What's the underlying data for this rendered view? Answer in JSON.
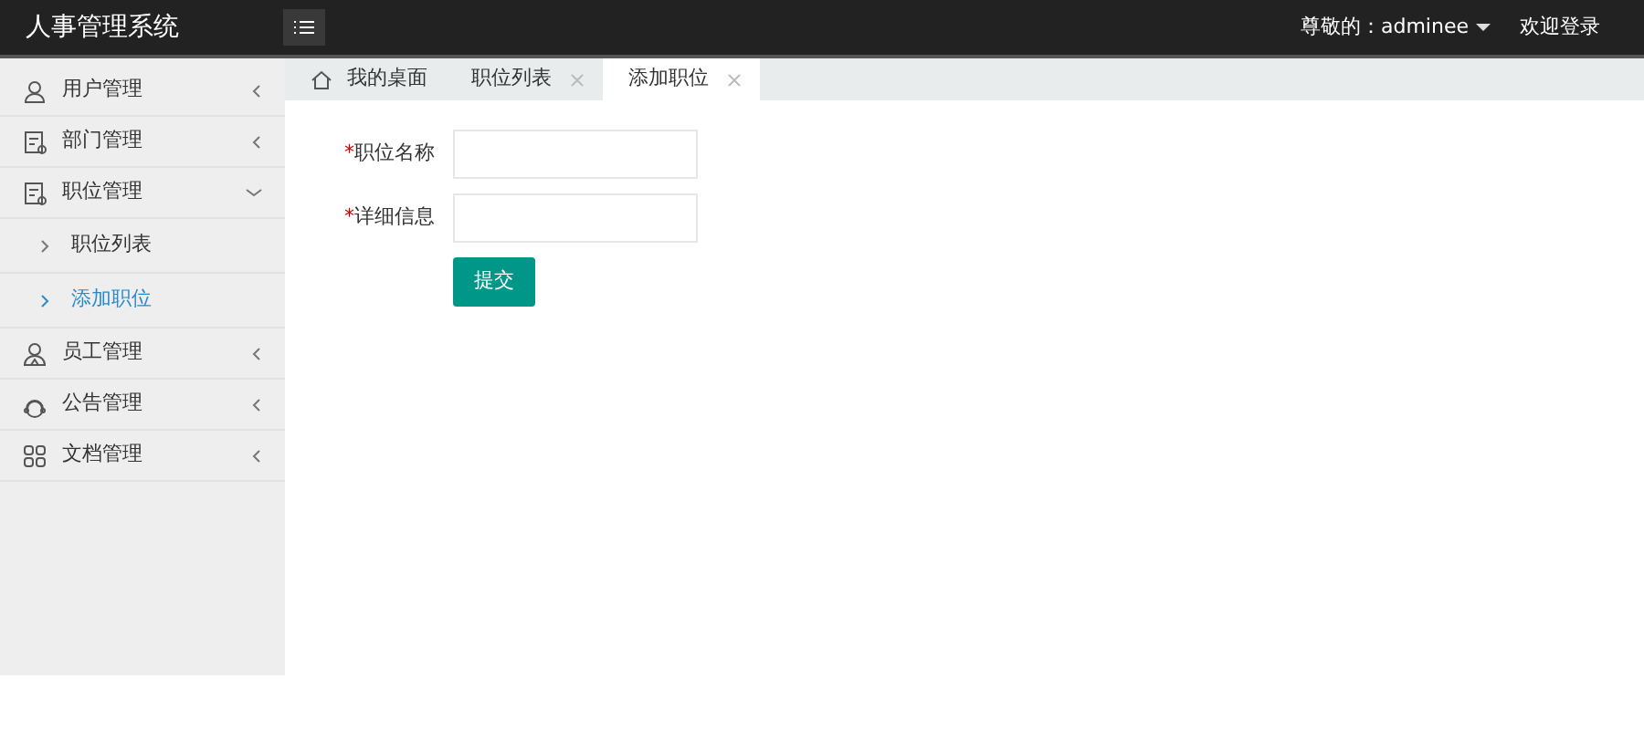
{
  "header": {
    "title": "人事管理系统",
    "user": "尊敬的：adminee",
    "welcome": "欢迎登录"
  },
  "sidebar": {
    "items": [
      {
        "label": "用户管理",
        "expanded": false
      },
      {
        "label": "部门管理",
        "expanded": false
      },
      {
        "label": "职位管理",
        "expanded": true,
        "children": [
          {
            "label": "职位列表",
            "selected": false
          },
          {
            "label": "添加职位",
            "selected": true
          }
        ]
      },
      {
        "label": "员工管理",
        "expanded": false
      },
      {
        "label": "公告管理",
        "expanded": false
      },
      {
        "label": "文档管理",
        "expanded": false
      }
    ]
  },
  "tabs": [
    {
      "label": "我的桌面",
      "kind": "home",
      "selected": false
    },
    {
      "label": "职位列表",
      "kind": "page",
      "selected": false
    },
    {
      "label": "添加职位",
      "kind": "page",
      "selected": true
    }
  ],
  "form": {
    "fields": [
      {
        "required_mark": "*",
        "label": "职位名称"
      },
      {
        "required_mark": "*",
        "label": "详细信息"
      }
    ],
    "submit": "提交"
  }
}
